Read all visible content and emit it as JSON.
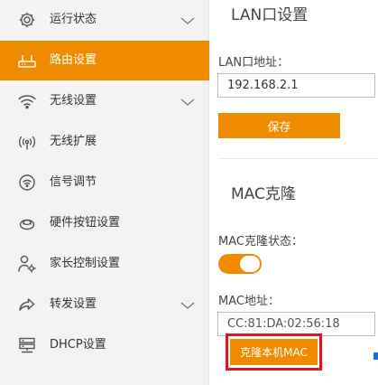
{
  "sidebar": {
    "items": [
      {
        "label": "运行状态",
        "icon": "gear-icon",
        "active": false,
        "expandable": true
      },
      {
        "label": "路由设置",
        "icon": "router-icon",
        "active": true,
        "expandable": false
      },
      {
        "label": "无线设置",
        "icon": "wifi-icon",
        "active": false,
        "expandable": true
      },
      {
        "label": "无线扩展",
        "icon": "broadcast-icon",
        "active": false,
        "expandable": false
      },
      {
        "label": "信号调节",
        "icon": "signal-icon",
        "active": false,
        "expandable": false
      },
      {
        "label": "硬件按钮设置",
        "icon": "hardware-button-icon",
        "active": false,
        "expandable": false
      },
      {
        "label": "家长控制设置",
        "icon": "parent-control-icon",
        "active": false,
        "expandable": false
      },
      {
        "label": "转发设置",
        "icon": "forward-icon",
        "active": false,
        "expandable": true
      },
      {
        "label": "DHCP设置",
        "icon": "server-icon",
        "active": false,
        "expandable": false
      }
    ]
  },
  "lan": {
    "title": "LAN口设置",
    "address_label": "LAN口地址：",
    "address_value": "192.168.2.1",
    "save_label": "保存"
  },
  "mac_clone": {
    "title": "MAC克隆",
    "status_label": "MAC克隆状态：",
    "enabled": true,
    "address_label": "MAC地址：",
    "address_value": "CC:81:DA:02:56:18",
    "clone_button_label": "克隆本机MAC"
  },
  "colors": {
    "accent": "#f08b00",
    "highlight": "#e0141e",
    "sidebar_bg": "#f3f3f3"
  }
}
